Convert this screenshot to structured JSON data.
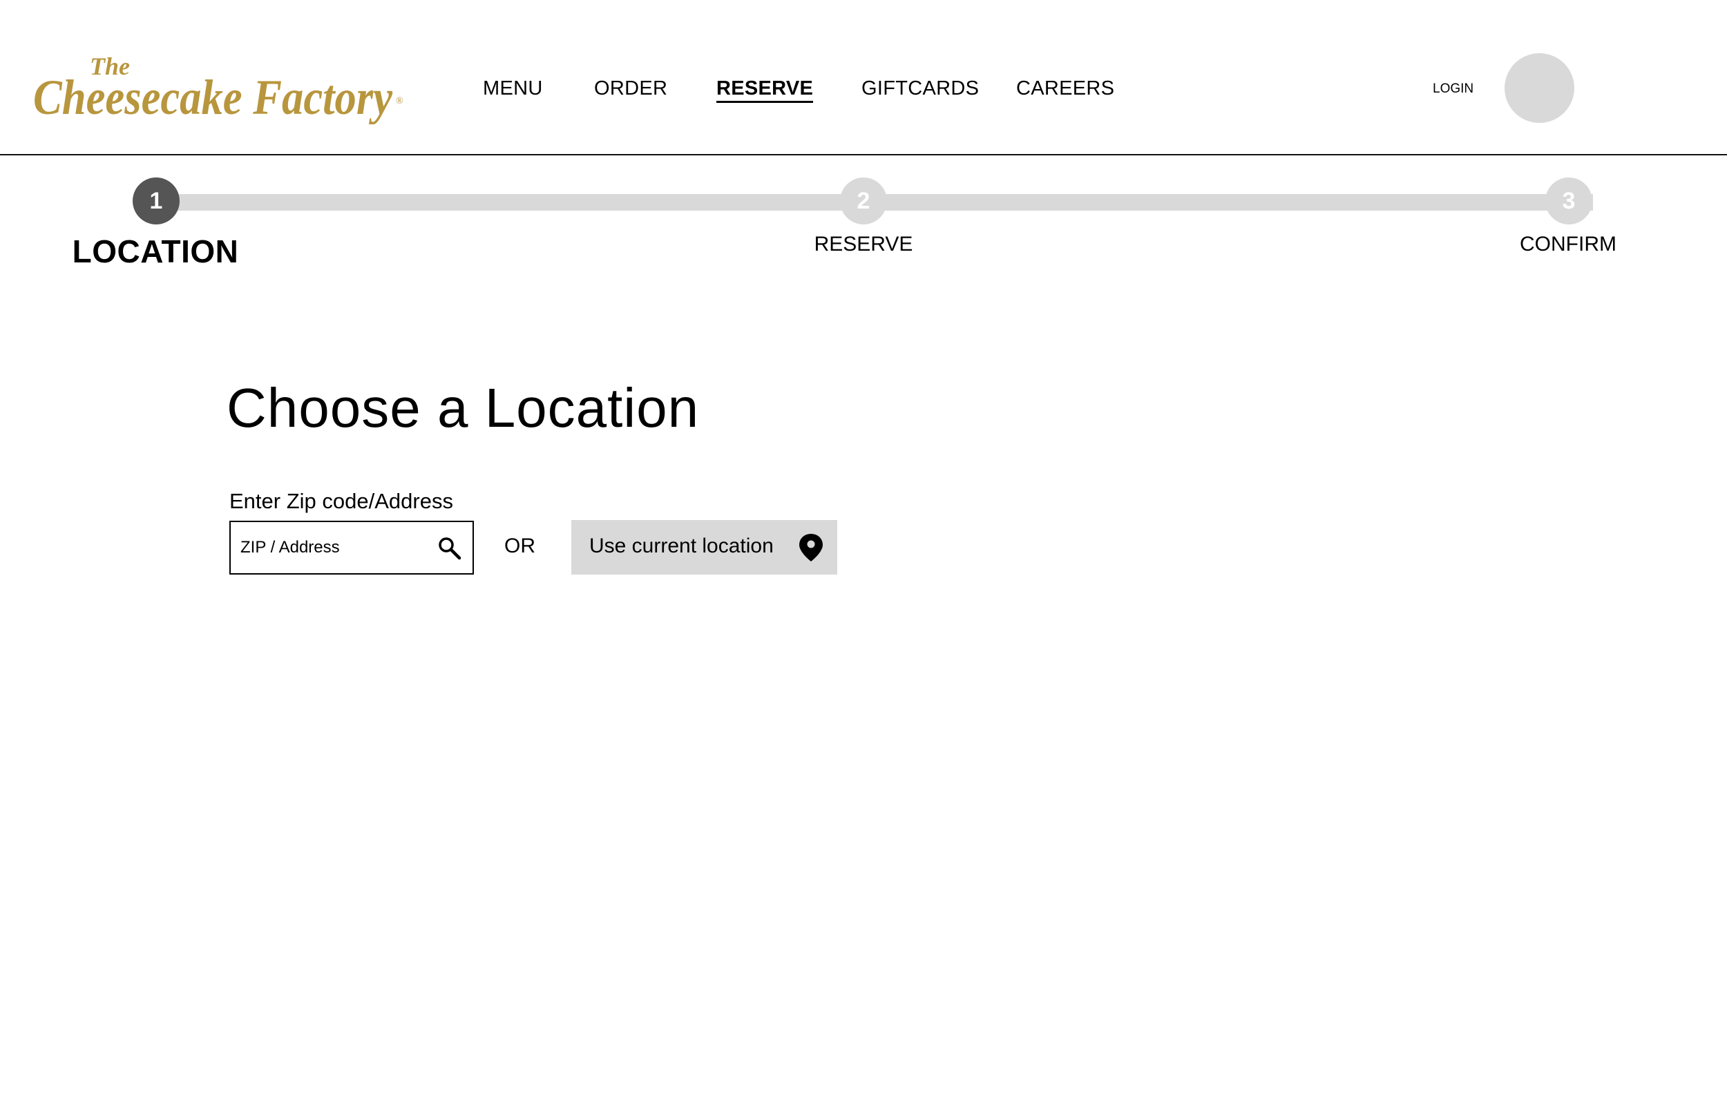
{
  "header": {
    "logo": {
      "line1": "The",
      "line2": "Cheesecake Factory",
      "mark": "®"
    },
    "nav": [
      {
        "label": "MENU",
        "active": false
      },
      {
        "label": "ORDER",
        "active": false
      },
      {
        "label": "RESERVE",
        "active": true
      },
      {
        "label": "GIFTCARDS",
        "active": false
      },
      {
        "label": "CAREERS",
        "active": false
      }
    ],
    "login_label": "LOGIN"
  },
  "stepper": {
    "current_step": 1,
    "steps": [
      {
        "number": "1",
        "label": "LOCATION"
      },
      {
        "number": "2",
        "label": "RESERVE"
      },
      {
        "number": "3",
        "label": "CONFIRM"
      }
    ]
  },
  "main": {
    "title": "Choose a Location",
    "search": {
      "label": "Enter Zip code/Address",
      "placeholder": "ZIP / Address",
      "value": "",
      "icon": "search-icon"
    },
    "or_text": "OR",
    "location_button": {
      "label": "Use current location",
      "icon": "map-pin-icon"
    }
  },
  "colors": {
    "brand_gold": "#B8963E",
    "step_active": "#555555",
    "step_inactive": "#D9D9D9",
    "button_bg": "#D9D9D9"
  }
}
